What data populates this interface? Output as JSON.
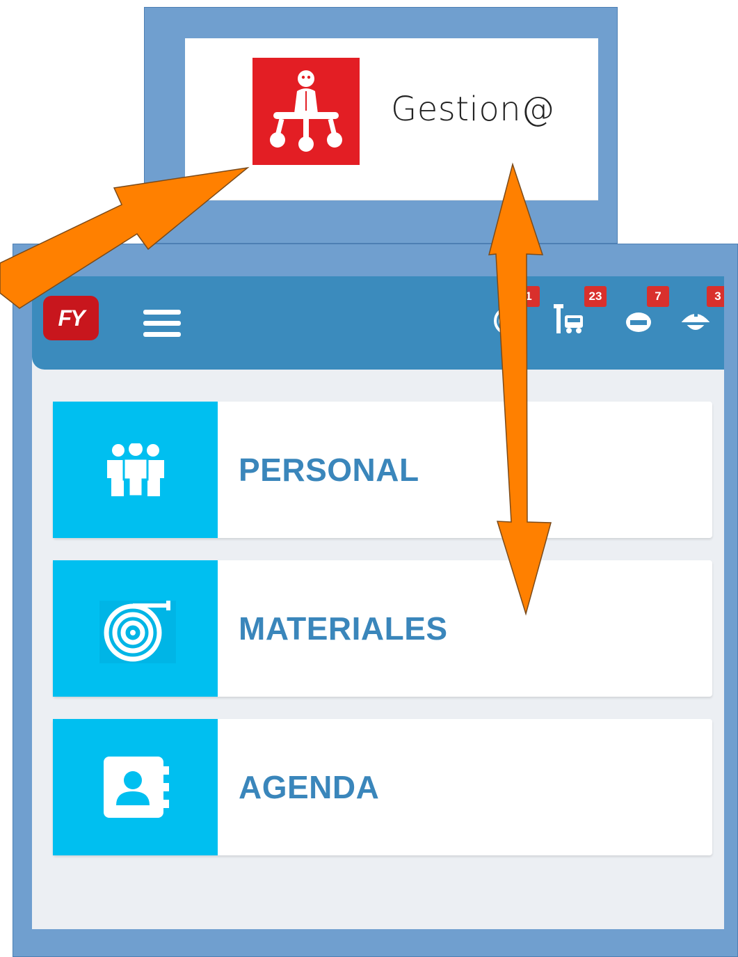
{
  "callout": {
    "app_name": "Gestion@",
    "app_icon": "org-chart-person-icon",
    "icon_color": "#e31e24"
  },
  "header": {
    "logo_text": "FY",
    "menu_icon": "hamburger-icon",
    "color": "#3b8bbd",
    "status_icons": [
      {
        "name": "hose-reel-icon",
        "badge": "1"
      },
      {
        "name": "vehicle-repair-icon",
        "badge": "23"
      },
      {
        "name": "no-entry-icon",
        "badge": "7"
      },
      {
        "name": "firefighter-helmet-icon",
        "badge": "3"
      }
    ]
  },
  "menu": {
    "items": [
      {
        "label": "PERSONAL",
        "icon": "people-group-icon"
      },
      {
        "label": "MATERIALES",
        "icon": "hose-reel-icon"
      },
      {
        "label": "AGENDA",
        "icon": "contact-book-icon"
      }
    ],
    "tile_color": "#00bff0",
    "label_color": "#3a86bb"
  },
  "annotations": {
    "arrow_color": "#ff8000"
  }
}
